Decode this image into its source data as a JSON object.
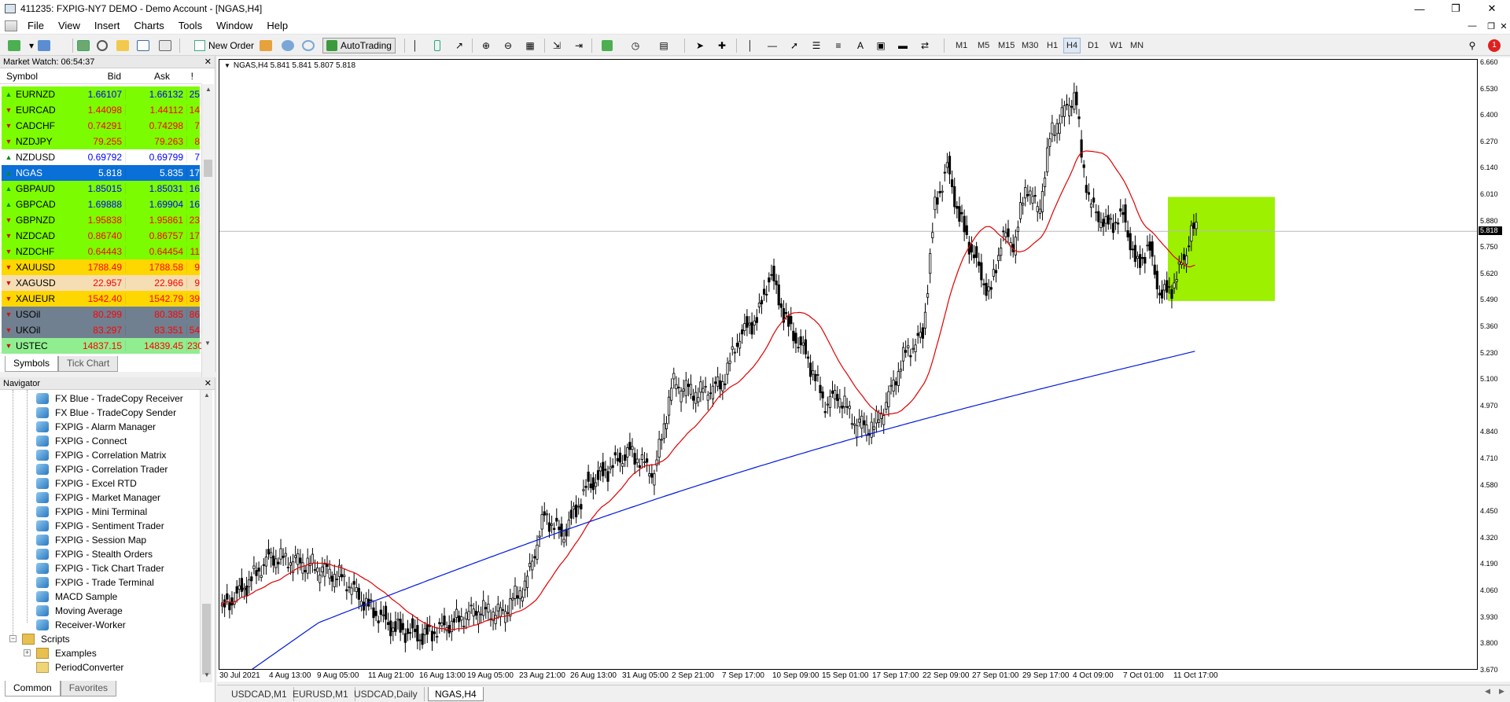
{
  "window": {
    "title": "411235: FXPIG-NY7 DEMO - Demo Account - [NGAS,H4]"
  },
  "menu": [
    "File",
    "View",
    "Insert",
    "Charts",
    "Tools",
    "Window",
    "Help"
  ],
  "toolbar": {
    "new_order": "New Order",
    "autotrading": "AutoTrading",
    "draw_letter_a": "A",
    "timeframes": [
      "M1",
      "M5",
      "M15",
      "M30",
      "H1",
      "H4",
      "D1",
      "W1",
      "MN"
    ],
    "active_timeframe": "H4",
    "notification_count": "1"
  },
  "market_watch": {
    "title": "Market Watch: 06:54:37",
    "columns": {
      "symbol": "Symbol",
      "bid": "Bid",
      "ask": "Ask",
      "spread": "!"
    },
    "rows": [
      {
        "dir": "up",
        "symbol": "EURNZD",
        "bid": "1.66107",
        "ask": "1.66132",
        "spread": "25",
        "bg": "#7cfc00",
        "fg": "#0000ff"
      },
      {
        "dir": "down",
        "symbol": "EURCAD",
        "bid": "1.44098",
        "ask": "1.44112",
        "spread": "14",
        "bg": "#7cfc00",
        "fg": "#ff0000"
      },
      {
        "dir": "down",
        "symbol": "CADCHF",
        "bid": "0.74291",
        "ask": "0.74298",
        "spread": "7",
        "bg": "#7cfc00",
        "fg": "#ff0000"
      },
      {
        "dir": "down",
        "symbol": "NZDJPY",
        "bid": "79.255",
        "ask": "79.263",
        "spread": "8",
        "bg": "#7cfc00",
        "fg": "#ff0000"
      },
      {
        "dir": "up",
        "symbol": "NZDUSD",
        "bid": "0.69792",
        "ask": "0.69799",
        "spread": "7",
        "bg": "#ffffff",
        "fg": "#0000ff"
      },
      {
        "dir": "up",
        "symbol": "NGAS",
        "bid": "5.818",
        "ask": "5.835",
        "spread": "17",
        "bg": "#0a6fd6",
        "fg": "#ffffff"
      },
      {
        "dir": "up",
        "symbol": "GBPAUD",
        "bid": "1.85015",
        "ask": "1.85031",
        "spread": "16",
        "bg": "#7cfc00",
        "fg": "#0000ff"
      },
      {
        "dir": "up",
        "symbol": "GBPCAD",
        "bid": "1.69888",
        "ask": "1.69904",
        "spread": "16",
        "bg": "#7cfc00",
        "fg": "#0000ff"
      },
      {
        "dir": "down",
        "symbol": "GBPNZD",
        "bid": "1.95838",
        "ask": "1.95861",
        "spread": "23",
        "bg": "#7cfc00",
        "fg": "#ff0000"
      },
      {
        "dir": "down",
        "symbol": "NZDCAD",
        "bid": "0.86740",
        "ask": "0.86757",
        "spread": "17",
        "bg": "#7cfc00",
        "fg": "#ff0000"
      },
      {
        "dir": "down",
        "symbol": "NZDCHF",
        "bid": "0.64443",
        "ask": "0.64454",
        "spread": "11",
        "bg": "#7cfc00",
        "fg": "#ff0000"
      },
      {
        "dir": "down",
        "symbol": "XAUUSD",
        "bid": "1788.49",
        "ask": "1788.58",
        "spread": "9",
        "bg": "#ffd700",
        "fg": "#ff0000"
      },
      {
        "dir": "down",
        "symbol": "XAGUSD",
        "bid": "22.957",
        "ask": "22.966",
        "spread": "9",
        "bg": "#f5deb3",
        "fg": "#ff0000"
      },
      {
        "dir": "down",
        "symbol": "XAUEUR",
        "bid": "1542.40",
        "ask": "1542.79",
        "spread": "39",
        "bg": "#ffd700",
        "fg": "#ff0000"
      },
      {
        "dir": "down",
        "symbol": "USOil",
        "bid": "80.299",
        "ask": "80.385",
        "spread": "86",
        "bg": "#708090",
        "fg": "#ff0000"
      },
      {
        "dir": "down",
        "symbol": "UKOil",
        "bid": "83.297",
        "ask": "83.351",
        "spread": "54",
        "bg": "#708090",
        "fg": "#ff0000"
      },
      {
        "dir": "down",
        "symbol": "USTEC",
        "bid": "14837.15",
        "ask": "14839.45",
        "spread": "230",
        "bg": "#90ee90",
        "fg": "#ff0000"
      }
    ],
    "tabs": [
      "Symbols",
      "Tick Chart"
    ]
  },
  "navigator": {
    "title": "Navigator",
    "items": [
      {
        "label": "FX Blue - TradeCopy Receiver",
        "kind": "ea"
      },
      {
        "label": "FX Blue - TradeCopy Sender",
        "kind": "ea"
      },
      {
        "label": "FXPIG - Alarm Manager",
        "kind": "ea"
      },
      {
        "label": "FXPIG - Connect",
        "kind": "ea"
      },
      {
        "label": "FXPIG - Correlation Matrix",
        "kind": "ea"
      },
      {
        "label": "FXPIG - Correlation Trader",
        "kind": "ea"
      },
      {
        "label": "FXPIG - Excel RTD",
        "kind": "ea"
      },
      {
        "label": "FXPIG - Market Manager",
        "kind": "ea"
      },
      {
        "label": "FXPIG - Mini Terminal",
        "kind": "ea"
      },
      {
        "label": "FXPIG - Sentiment Trader",
        "kind": "ea"
      },
      {
        "label": "FXPIG - Session Map",
        "kind": "ea"
      },
      {
        "label": "FXPIG - Stealth Orders",
        "kind": "ea"
      },
      {
        "label": "FXPIG - Tick Chart Trader",
        "kind": "ea"
      },
      {
        "label": "FXPIG - Trade Terminal",
        "kind": "ea"
      },
      {
        "label": "MACD Sample",
        "kind": "ea"
      },
      {
        "label": "Moving Average",
        "kind": "ea"
      },
      {
        "label": "Receiver-Worker",
        "kind": "ea"
      },
      {
        "label": "Scripts",
        "kind": "folder"
      },
      {
        "label": "Examples",
        "kind": "subfolder"
      },
      {
        "label": "PeriodConverter",
        "kind": "script"
      }
    ],
    "tabs": [
      "Common",
      "Favorites"
    ]
  },
  "chart": {
    "header": "NGAS,H4  5.841 5.841 5.807 5.818",
    "current_price": "5.818",
    "price_labels": [
      "6.660",
      "6.530",
      "6.400",
      "6.270",
      "6.140",
      "6.010",
      "5.880",
      "5.750",
      "5.620",
      "5.490",
      "5.360",
      "5.230",
      "5.100",
      "4.970",
      "4.840",
      "4.710",
      "4.580",
      "4.450",
      "4.320",
      "4.190",
      "4.060",
      "3.930",
      "3.800",
      "3.670"
    ],
    "time_labels": [
      "30 Jul 2021",
      "4 Aug 13:00",
      "9 Aug 05:00",
      "11 Aug 21:00",
      "16 Aug 13:00",
      "19 Aug 05:00",
      "23 Aug 21:00",
      "26 Aug 13:00",
      "31 Aug 05:00",
      "2 Sep 21:00",
      "7 Sep 17:00",
      "10 Sep 09:00",
      "15 Sep 01:00",
      "17 Sep 17:00",
      "22 Sep 09:00",
      "27 Sep 01:00",
      "29 Sep 17:00",
      "4 Oct 09:00",
      "7 Oct 01:00",
      "11 Oct 17:00"
    ],
    "colors": {
      "ma_fast": "#e00000",
      "ma_slow": "#0018e0",
      "highlight": "#9cf000"
    }
  },
  "chart_tabs": [
    "USDCAD,M1",
    "EURUSD,M1",
    "USDCAD,Daily",
    "NGAS,H4"
  ],
  "active_chart_tab": "NGAS,H4"
}
